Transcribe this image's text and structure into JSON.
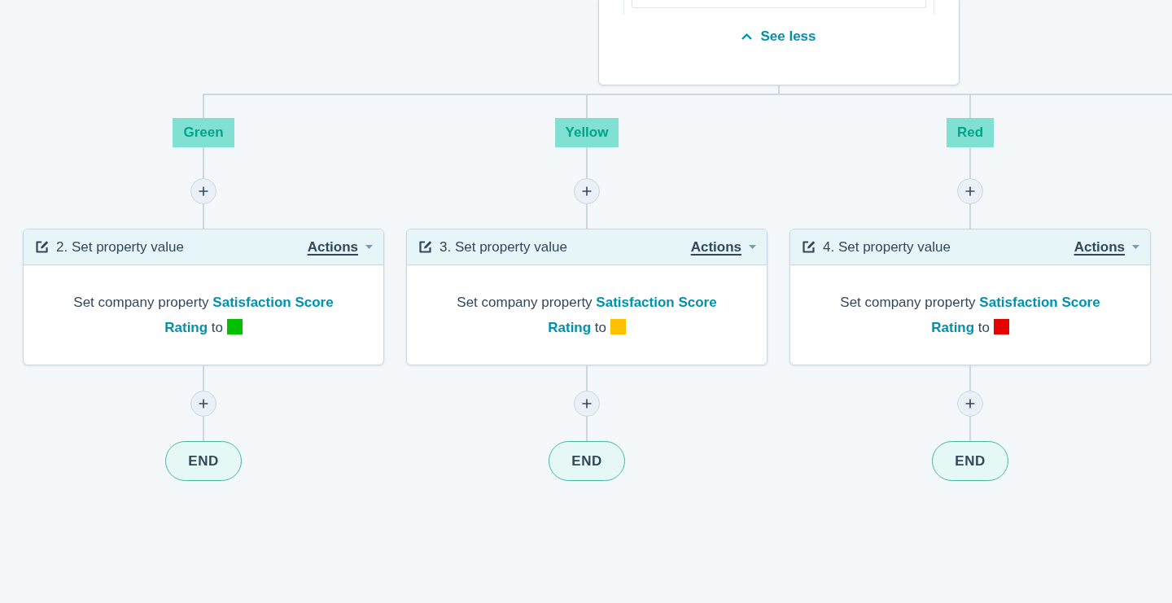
{
  "top_card": {
    "toggle_link": {
      "label": "See less"
    }
  },
  "branches": [
    {
      "label": "Green",
      "action": {
        "title": "2. Set property value",
        "menu_label": "Actions",
        "description": "Set company property **Satisfaction Score Rating** to",
        "color": "#00c000"
      },
      "end_label": "END"
    },
    {
      "label": "Yellow",
      "action": {
        "title": "3. Set property value",
        "menu_label": "Actions",
        "description": "Set company property **Satisfaction Score Rating** to",
        "color": "#ffc000"
      },
      "end_label": "END"
    },
    {
      "label": "Red",
      "action": {
        "title": "4. Set property value",
        "menu_label": "Actions",
        "description": "Set company property **Satisfaction Score Rating** to",
        "color": "#e60000"
      },
      "end_label": "END"
    }
  ]
}
